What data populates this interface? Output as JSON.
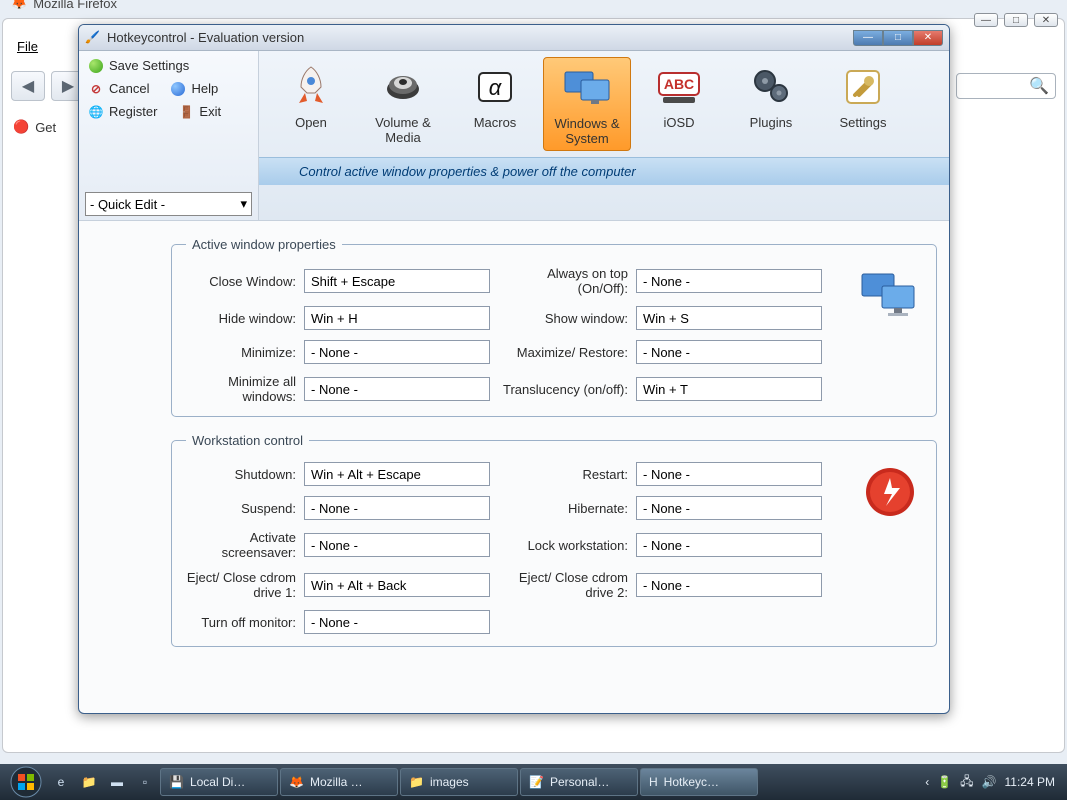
{
  "bg": {
    "title": "Mozilla Firefox",
    "menu_file": "File",
    "tab_label": "Get"
  },
  "dialog": {
    "title": "Hotkeycontrol - Evaluation version"
  },
  "left_panel": {
    "save": "Save Settings",
    "cancel": "Cancel",
    "help": "Help",
    "register": "Register",
    "exit": "Exit",
    "quick_edit": "- Quick Edit -"
  },
  "toolbar": {
    "open": "Open",
    "volume": "Volume & Media",
    "macros": "Macros",
    "windows": "Windows & System",
    "iosd": "iOSD",
    "plugins": "Plugins",
    "settings": "Settings",
    "description": "Control active window properties & power off the computer"
  },
  "groups": {
    "active": {
      "legend": "Active window properties",
      "close_window": {
        "label": "Close Window:",
        "value": "Shift + Escape"
      },
      "always_top": {
        "label": "Always on top (On/Off):",
        "value": "- None -"
      },
      "hide_window": {
        "label": "Hide window:",
        "value": "Win + H"
      },
      "show_window": {
        "label": "Show window:",
        "value": "Win + S"
      },
      "minimize": {
        "label": "Minimize:",
        "value": "- None -"
      },
      "max_restore": {
        "label": "Maximize/ Restore:",
        "value": "- None -"
      },
      "minimize_all": {
        "label": "Minimize all windows:",
        "value": "- None -"
      },
      "translucency": {
        "label": "Translucency (on/off):",
        "value": "Win + T"
      }
    },
    "workstation": {
      "legend": "Workstation control",
      "shutdown": {
        "label": "Shutdown:",
        "value": "Win + Alt + Escape"
      },
      "restart": {
        "label": "Restart:",
        "value": "- None -"
      },
      "suspend": {
        "label": "Suspend:",
        "value": "- None -"
      },
      "hibernate": {
        "label": "Hibernate:",
        "value": "- None -"
      },
      "screensaver": {
        "label": "Activate screensaver:",
        "value": "- None -"
      },
      "lock": {
        "label": "Lock workstation:",
        "value": "- None -"
      },
      "eject1": {
        "label": "Eject/ Close cdrom drive 1:",
        "value": "Win + Alt + Back"
      },
      "eject2": {
        "label": "Eject/ Close cdrom drive 2:",
        "value": "- None -"
      },
      "monitor": {
        "label": "Turn off monitor:",
        "value": "- None -"
      }
    }
  },
  "taskbar": {
    "tasks": [
      "Local Di…",
      "Mozilla …",
      "images",
      "Personal…",
      "Hotkeyc…"
    ],
    "time": "11:24 PM"
  }
}
